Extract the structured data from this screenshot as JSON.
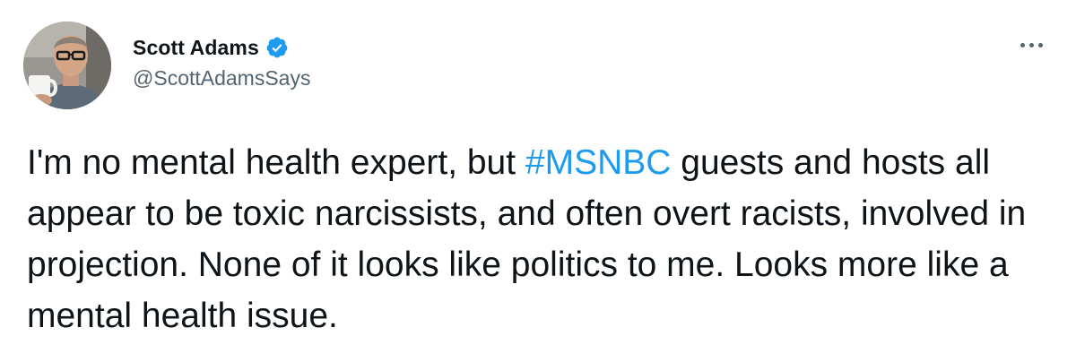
{
  "author": {
    "display_name": "Scott Adams",
    "handle": "@ScottAdamsSays",
    "verified": true,
    "avatar_icon": "profile-photo"
  },
  "tweet": {
    "text_before": "I'm no mental health expert, but ",
    "hashtag": "#MSNBC",
    "text_after": " guests and hosts all appear to be toxic narcissists, and often overt racists, involved in projection. None of it looks like politics to me. Looks more like a mental health issue."
  },
  "colors": {
    "text": "#0f1419",
    "secondary": "#536471",
    "link": "#1d9bf0",
    "verified_badge": "#1d9bf0"
  },
  "icons": {
    "verified": "verified-badge-icon",
    "more": "more-options-icon"
  }
}
